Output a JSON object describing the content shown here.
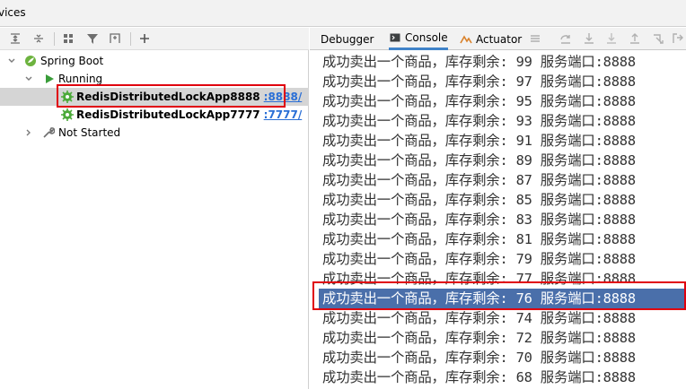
{
  "window": {
    "title": "vices"
  },
  "services_tree": {
    "items": [
      {
        "label": "Spring Boot"
      },
      {
        "label": "Running"
      },
      {
        "label": "RedisDistributedLockApp8888",
        "port_link": ":8888/"
      },
      {
        "label": "RedisDistributedLockApp7777",
        "port_link": ":7777/"
      },
      {
        "label": "Not Started"
      }
    ]
  },
  "tabs": [
    {
      "label": "Debugger"
    },
    {
      "label": "Console"
    },
    {
      "label": "Actuator"
    }
  ],
  "console": {
    "lines": [
      "成功卖出一个商品，库存剩余: 99 服务端口:8888",
      "成功卖出一个商品，库存剩余: 97 服务端口:8888",
      "成功卖出一个商品，库存剩余: 95 服务端口:8888",
      "成功卖出一个商品，库存剩余: 93 服务端口:8888",
      "成功卖出一个商品，库存剩余: 91 服务端口:8888",
      "成功卖出一个商品，库存剩余: 89 服务端口:8888",
      "成功卖出一个商品，库存剩余: 87 服务端口:8888",
      "成功卖出一个商品，库存剩余: 85 服务端口:8888",
      "成功卖出一个商品，库存剩余: 83 服务端口:8888",
      "成功卖出一个商品，库存剩余: 81 服务端口:8888",
      "成功卖出一个商品，库存剩余: 79 服务端口:8888",
      "成功卖出一个商品，库存剩余: 77 服务端口:8888",
      "成功卖出一个商品，库存剩余: 76 服务端口:8888",
      "成功卖出一个商品，库存剩余: 74 服务端口:8888",
      "成功卖出一个商品，库存剩余: 72 服务端口:8888",
      "成功卖出一个商品，库存剩余: 70 服务端口:8888",
      "成功卖出一个商品，库存剩余: 68 服务端口:8888"
    ],
    "highlighted_index": 12
  },
  "colors": {
    "selection": "#4a6faa",
    "annotation_box": "#e0000e",
    "link": "#2a6fd6",
    "tab_underline": "#4083c9"
  }
}
